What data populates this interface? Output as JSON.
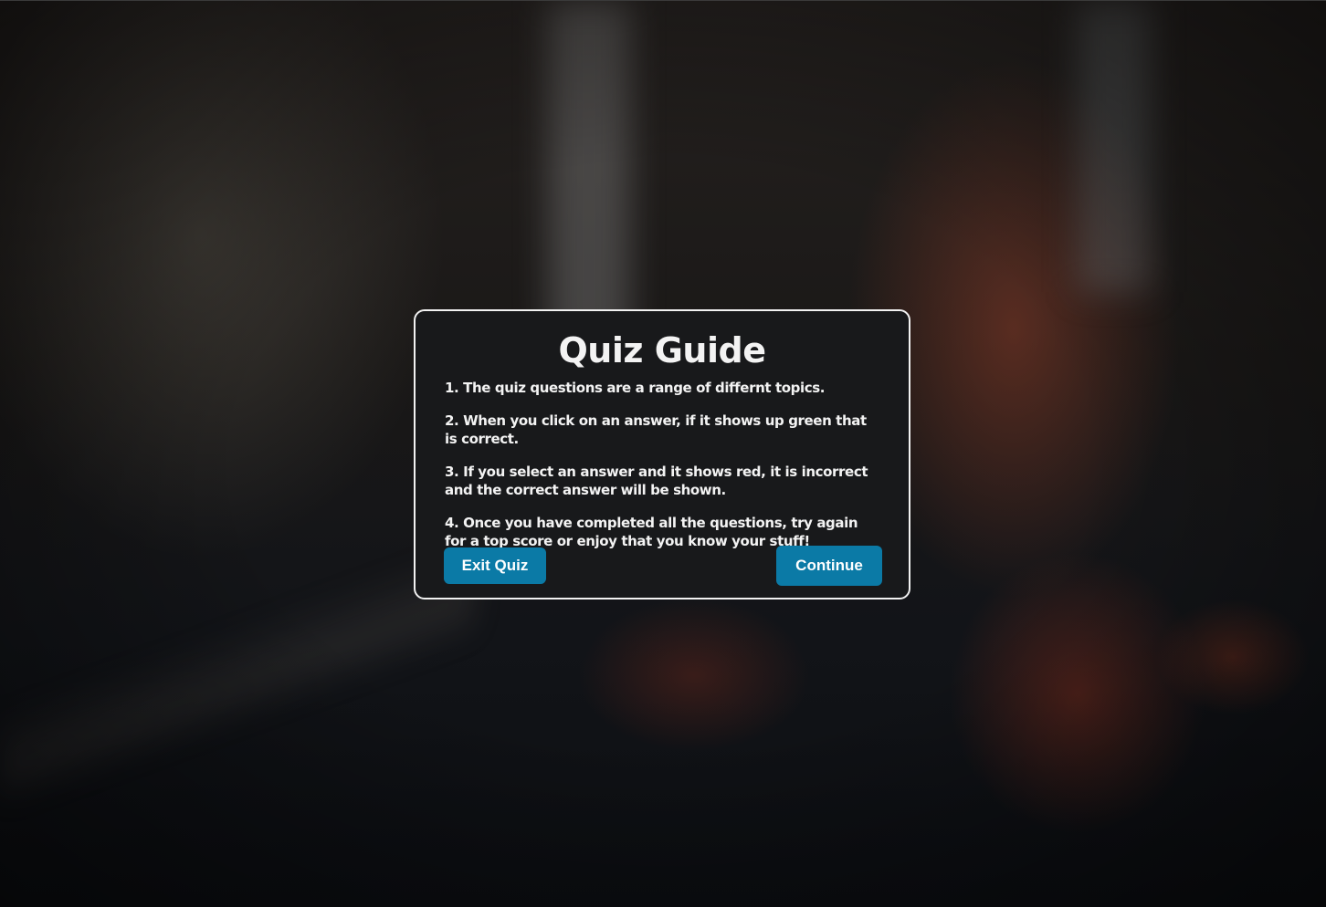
{
  "modal": {
    "title": "Quiz Guide",
    "rules": [
      "1. The quiz questions are a range of differnt topics.",
      "2. When you click on an answer, if it shows up green that is correct.",
      "3. If you select an answer and it shows red, it is incorrect and the correct answer will be shown.",
      "4. Once you have completed all the questions, try again for a top score or enjoy that you know your stuff!"
    ],
    "exit_label": "Exit Quiz",
    "continue_label": "Continue"
  },
  "colors": {
    "button": "#0b7aa6",
    "modal_background": "#18191b",
    "modal_border": "#f2f2f2",
    "text": "#f3f3f3"
  }
}
